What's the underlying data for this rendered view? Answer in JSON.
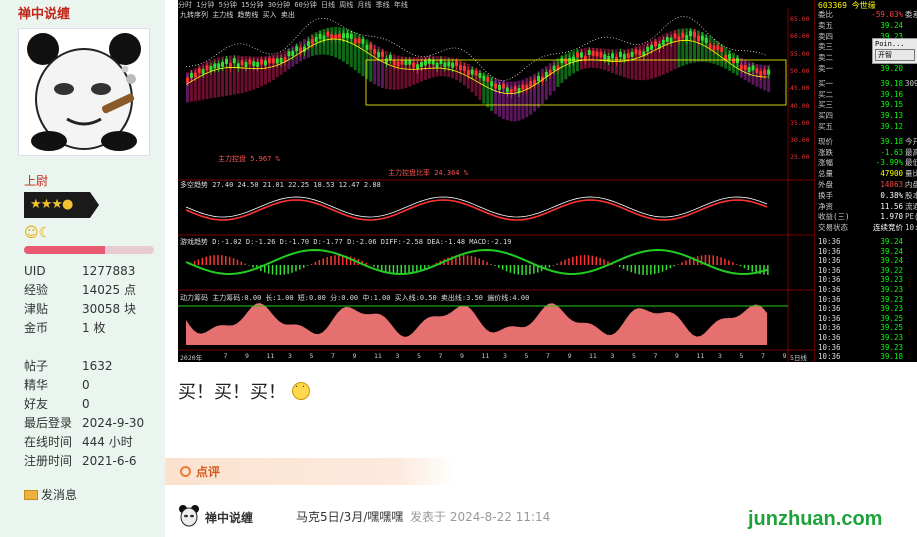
{
  "sidebar": {
    "username": "禅中说缠",
    "rank_title": "上尉",
    "level_fraction": 0.62,
    "stats": [
      {
        "label": "UID",
        "value": "1277883"
      },
      {
        "label": "经验",
        "value": "14025 点"
      },
      {
        "label": "津贴",
        "value": "30058 块"
      },
      {
        "label": "金币",
        "value": "1 枚"
      }
    ],
    "stats2": [
      {
        "label": "帖子",
        "value": "1632"
      },
      {
        "label": "精华",
        "value": "0"
      },
      {
        "label": "好友",
        "value": "0"
      },
      {
        "label": "最后登录",
        "value": "2024-9-30"
      },
      {
        "label": "在线时间",
        "value": "444 小时"
      },
      {
        "label": "注册时间",
        "value": "2021-6-6"
      }
    ],
    "send_message": "发消息"
  },
  "chart": {
    "topbar": "分时 1分钟 5分钟 15分钟 30分钟 60分钟 日线 周线 月线 季线 年线",
    "indicator_lines": [
      {
        "text": "九转序列 主力线 趋势线 买入 卖出",
        "color": "#dddddd"
      },
      {
        "text": "主力控盘 5.967 %",
        "color": "#ff5555"
      },
      {
        "text": "主力控盘比率 24.364 %",
        "color": "#ff5555"
      },
      {
        "text": "多空趋势 27.40 24.50 21.01 22.25 18.53 12.47 2.88",
        "color": "#dddddd"
      },
      {
        "text": "游戏趋势 D:-1.02 D:-1.26 D:-1.70 D:-1.77 D:-2.06 DIFF:-2.58 DEA:-1.48 MACD:-2.19",
        "color": "#dddddd"
      },
      {
        "text": "动力筹码 主力筹码:0.00 长:1.00 短:0.00 分:0.00 中:1.00 买入线:0.50 卖出线:3.50 遍价线:4.00",
        "color": "#dddddd"
      }
    ],
    "price_ticks": [
      "65.00",
      "60.00",
      "55.00",
      "50.00",
      "45.00",
      "40.00",
      "35.00",
      "30.00",
      "25.00"
    ],
    "x_labels": [
      "2020年",
      "7",
      "9",
      "11",
      "3",
      "5",
      "7",
      "9",
      "11",
      "3",
      "5",
      "7",
      "9",
      "11",
      "3",
      "5",
      "7",
      "9",
      "11",
      "3",
      "5",
      "7",
      "9",
      "11",
      "3",
      "5",
      "7",
      "9"
    ],
    "period_label": "5日线",
    "stock_code": "603369",
    "stock_name": "今世缘",
    "quote_rows": [
      {
        "k": "委比",
        "v": "-59.03%",
        "x": "委差",
        "color": "#ff4444"
      },
      {
        "k": "卖五",
        "v": "39.24",
        "x": "",
        "color": "#00ff00"
      },
      {
        "k": "卖四",
        "v": "39.23",
        "x": "",
        "color": "#00ff00"
      },
      {
        "k": "卖三",
        "v": "39.22",
        "x": "",
        "color": "#00ff00"
      },
      {
        "k": "卖二",
        "v": "39.21",
        "x": "",
        "color": "#00ff00"
      },
      {
        "k": "卖一",
        "v": "39.20",
        "x": "",
        "color": "#00ff00"
      },
      {
        "k": "买一",
        "v": "39.18",
        "x": "309",
        "color": "#00ff00"
      },
      {
        "k": "买二",
        "v": "39.16",
        "x": "",
        "color": "#00ff00"
      },
      {
        "k": "买三",
        "v": "39.15",
        "x": "",
        "color": "#00ff00"
      },
      {
        "k": "买四",
        "v": "39.13",
        "x": "",
        "color": "#00ff00"
      },
      {
        "k": "买五",
        "v": "39.12",
        "x": "",
        "color": "#00ff00"
      },
      {
        "k": "现价",
        "v": "39.18",
        "x": "今开",
        "color": "#00ff00"
      },
      {
        "k": "涨跌",
        "v": "-1.63",
        "x": "最高",
        "color": "#00ff00"
      },
      {
        "k": "涨幅",
        "v": "-3.99%",
        "x": "最低",
        "color": "#00ff00"
      },
      {
        "k": "总量",
        "v": "47900",
        "x": "量比",
        "color": "#ffff00"
      },
      {
        "k": "外盘",
        "v": "14863",
        "x": "内盘",
        "color": "#ff4444"
      },
      {
        "k": "换手",
        "v": "0.38%",
        "x": "股本",
        "color": "#ffffff"
      },
      {
        "k": "净资",
        "v": "11.56",
        "x": "流通",
        "color": "#ffffff"
      },
      {
        "k": "收益(三)",
        "v": "1.970",
        "x": "PE(动)",
        "color": "#ffffff"
      },
      {
        "k": "交易状态",
        "v": "连续竞价",
        "x": "10:36",
        "color": "#ffffff"
      }
    ],
    "ticks": [
      {
        "t": "10:36",
        "p": "39.24"
      },
      {
        "t": "10:36",
        "p": "39.24"
      },
      {
        "t": "10:36",
        "p": "39.24"
      },
      {
        "t": "10:36",
        "p": "39.22"
      },
      {
        "t": "10:36",
        "p": "39.23"
      },
      {
        "t": "10:36",
        "p": "39.23"
      },
      {
        "t": "10:36",
        "p": "39.23"
      },
      {
        "t": "10:36",
        "p": "39.23"
      },
      {
        "t": "10:36",
        "p": "39.25"
      },
      {
        "t": "10:36",
        "p": "39.25"
      },
      {
        "t": "10:36",
        "p": "39.23"
      },
      {
        "t": "10:36",
        "p": "39.23"
      },
      {
        "t": "10:36",
        "p": "39.18"
      }
    ],
    "popup_label": "Poin...",
    "popup_button": "开智"
  },
  "post": {
    "reply_text": "买！买！买！",
    "comment_label": "点评",
    "author": "禅中说缠",
    "title": "马克5日/3月/嘿嘿嘿",
    "time": "发表于 2024-8-22 11:14"
  },
  "watermark": "junzhuan.com"
}
